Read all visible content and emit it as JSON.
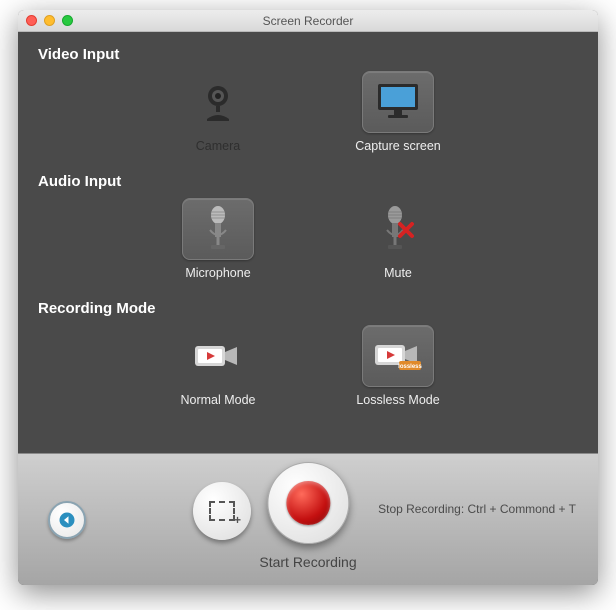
{
  "window": {
    "title": "Screen Recorder"
  },
  "sections": {
    "video": {
      "title": "Video Input",
      "camera": "Camera",
      "capture": "Capture screen"
    },
    "audio": {
      "title": "Audio Input",
      "mic": "Microphone",
      "mute": "Mute"
    },
    "mode": {
      "title": "Recording Mode",
      "normal": "Normal Mode",
      "lossless": "Lossless Mode"
    }
  },
  "footer": {
    "start": "Start Recording",
    "shortcut": "Stop Recording: Ctrl + Commond + T"
  }
}
